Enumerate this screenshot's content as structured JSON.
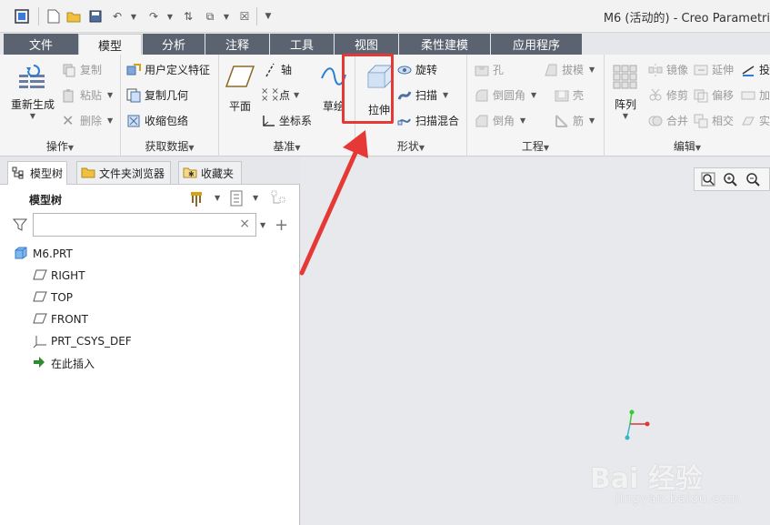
{
  "window": {
    "title": "M6 (活动的) - Creo Parametri"
  },
  "tabs": [
    {
      "label": "文件",
      "active": false
    },
    {
      "label": "模型",
      "active": true
    },
    {
      "label": "分析",
      "active": false
    },
    {
      "label": "注释",
      "active": false
    },
    {
      "label": "工具",
      "active": false
    },
    {
      "label": "视图",
      "active": false
    },
    {
      "label": "柔性建模",
      "active": false
    },
    {
      "label": "应用程序",
      "active": false
    }
  ],
  "ribbon": {
    "operations": {
      "label": "操作",
      "regenerate": "重新生成",
      "copy": "复制",
      "paste": "粘贴",
      "delete": "删除"
    },
    "get_data": {
      "label": "获取数据",
      "udf": "用户定义特征",
      "copy_geometry": "复制几何",
      "shrinkwrap": "收缩包络"
    },
    "datum": {
      "label": "基准",
      "plane": "平面",
      "axis": "轴",
      "point": "点",
      "csys": "坐标系",
      "sketch": "草绘"
    },
    "shapes": {
      "label": "形状",
      "extrude": "拉伸",
      "revolve": "旋转",
      "sweep": "扫描",
      "swept_blend": "扫描混合"
    },
    "engineering": {
      "label": "工程",
      "hole": "孔",
      "draft": "拔模",
      "round": "倒圆角",
      "shell": "壳",
      "chamfer": "倒角",
      "rib": "筋"
    },
    "editing": {
      "label": "编辑",
      "pattern": "阵列",
      "mirror": "镜像",
      "extend": "延伸",
      "project": "投",
      "trim": "修剪",
      "offset": "偏移",
      "thicken": "加",
      "merge": "合并",
      "intersect": "相交",
      "solidify": "实"
    }
  },
  "panel": {
    "tabs": [
      {
        "label": "模型树"
      },
      {
        "label": "文件夹浏览器"
      },
      {
        "label": "收藏夹"
      }
    ],
    "tree_title": "模型树",
    "filter": {
      "value": "",
      "clear": "×"
    },
    "tree": [
      {
        "label": "M6.PRT",
        "icon": "part-icon"
      },
      {
        "label": "RIGHT",
        "icon": "datum-plane-icon"
      },
      {
        "label": "TOP",
        "icon": "datum-plane-icon"
      },
      {
        "label": "FRONT",
        "icon": "datum-plane-icon"
      },
      {
        "label": "PRT_CSYS_DEF",
        "icon": "csys-icon"
      },
      {
        "label": "在此插入",
        "icon": "insert-here-icon"
      }
    ]
  },
  "watermark": {
    "brand": "Bai 经验",
    "url": "jingyan.baidu.com"
  },
  "colors": {
    "highlight": "#e53935",
    "tab_dark": "#5b6371",
    "ribbon": "#f5f5f5"
  }
}
